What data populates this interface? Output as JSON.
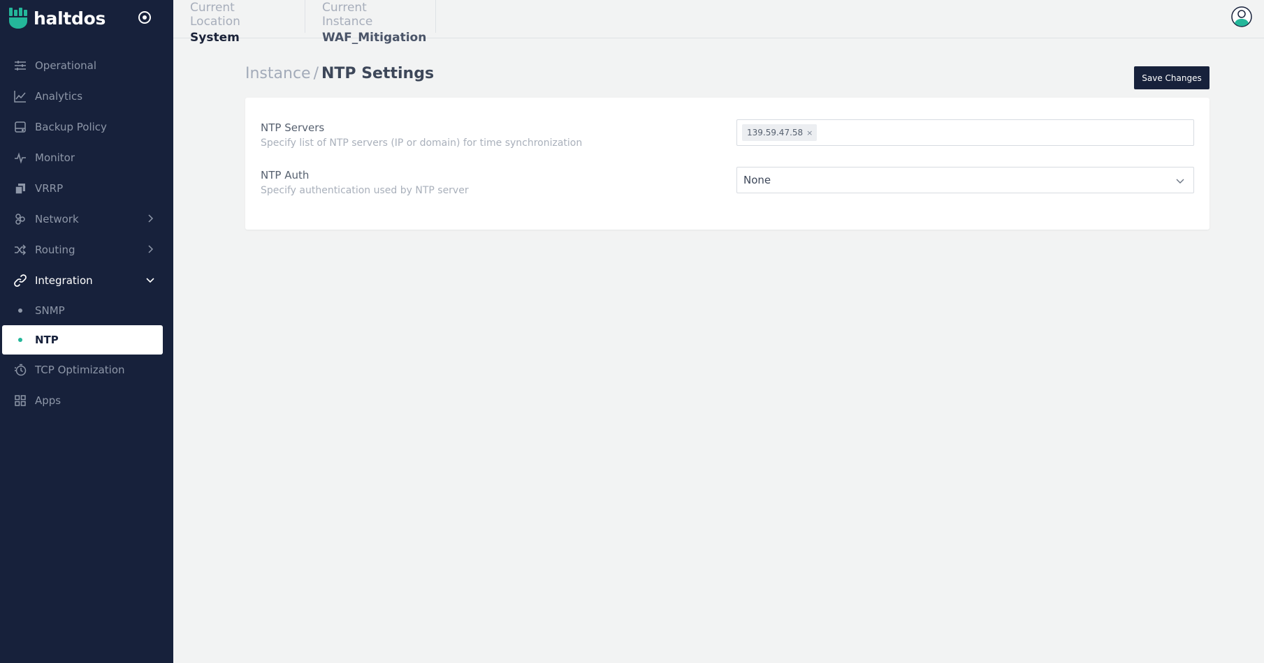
{
  "brand": {
    "name": "haltdos",
    "accent": "#24b79a"
  },
  "header": {
    "location_label": "Current Location",
    "location_value": "System",
    "instance_label": "Current Instance",
    "instance_value": "WAF_Mitigation"
  },
  "sidebar": {
    "items": [
      {
        "label": "Operational",
        "icon": "sliders-icon"
      },
      {
        "label": "Analytics",
        "icon": "chart-line-icon"
      },
      {
        "label": "Backup Policy",
        "icon": "hard-drive-icon"
      },
      {
        "label": "Monitor",
        "icon": "pulse-icon"
      },
      {
        "label": "VRRP",
        "icon": "copy-icon"
      },
      {
        "label": "Network",
        "icon": "network-icon"
      },
      {
        "label": "Routing",
        "icon": "shuffle-icon"
      },
      {
        "label": "Integration",
        "icon": "link-icon"
      },
      {
        "label": "TCP Optimization",
        "icon": "timer-icon"
      },
      {
        "label": "Apps",
        "icon": "grid-icon"
      }
    ],
    "integration_children": [
      {
        "label": "SNMP"
      },
      {
        "label": "NTP",
        "active": true
      }
    ]
  },
  "page": {
    "breadcrumb_parent": "Instance",
    "breadcrumb_sep": "/",
    "breadcrumb_current": "NTP Settings",
    "save_label": "Save Changes"
  },
  "form": {
    "ntp_servers": {
      "title": "NTP Servers",
      "description": "Specify list of NTP servers (IP or domain) for time synchronization",
      "tags": [
        "139.59.47.58"
      ],
      "remove_glyph": "×"
    },
    "ntp_auth": {
      "title": "NTP Auth",
      "description": "Specify authentication used by NTP server",
      "value": "None"
    }
  }
}
